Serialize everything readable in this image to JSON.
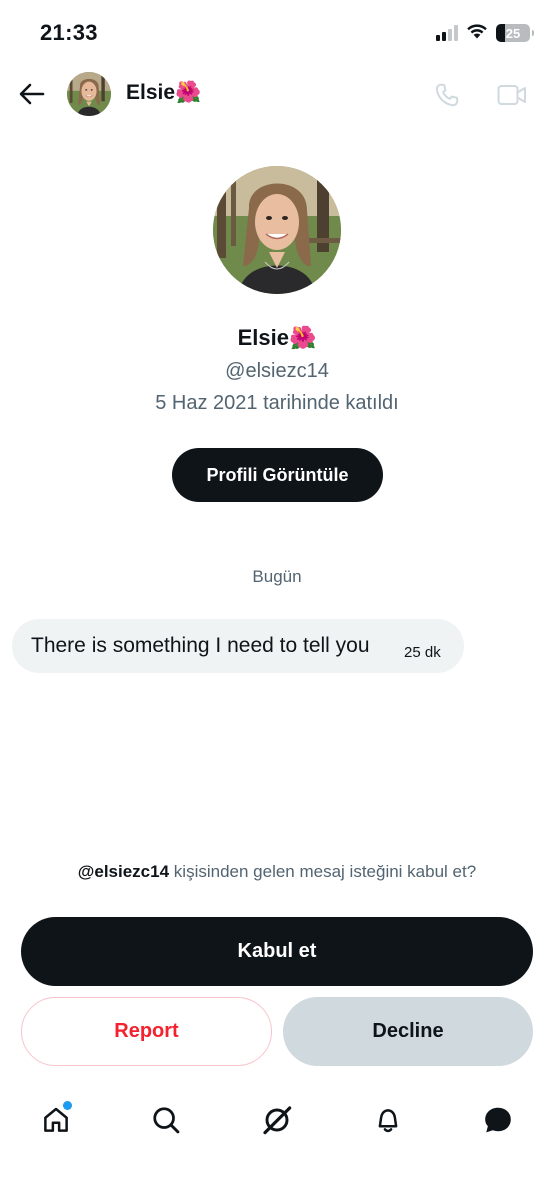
{
  "status_bar": {
    "time": "21:33",
    "battery": "25",
    "battery_fraction": 0.25,
    "icons": [
      "cellular-signal-icon",
      "wifi-icon",
      "battery-icon"
    ]
  },
  "header": {
    "name": "Elsie🌺",
    "icons": [
      "back-arrow-icon",
      "phone-icon",
      "video-camera-icon"
    ]
  },
  "profile": {
    "name": "Elsie🌺",
    "handle": "@elsiezc14",
    "joined": "5 Haz 2021 tarihinde katıldı",
    "view_button": "Profili Görüntüle"
  },
  "conversation": {
    "date_separator": "Bugün",
    "messages": [
      {
        "text": "There is something I need to tell you",
        "time": "25 dk"
      }
    ]
  },
  "request": {
    "handle": "@elsiezc14",
    "prompt_rest": " kişisinden gelen mesaj isteğini kabul et?",
    "accept": "Kabul et",
    "report": "Report",
    "decline": "Decline"
  },
  "bottom_nav": {
    "items": [
      "home-icon",
      "search-icon",
      "grok-icon",
      "notifications-icon",
      "messages-icon"
    ],
    "home_has_new": true
  },
  "colors": {
    "text_primary": "#0f1419",
    "text_secondary": "#536471",
    "bubble_bg": "#eff3f4",
    "danger": "#f4212e",
    "decline_bg": "#cfd9de",
    "accent_dot": "#1d9bf0"
  }
}
